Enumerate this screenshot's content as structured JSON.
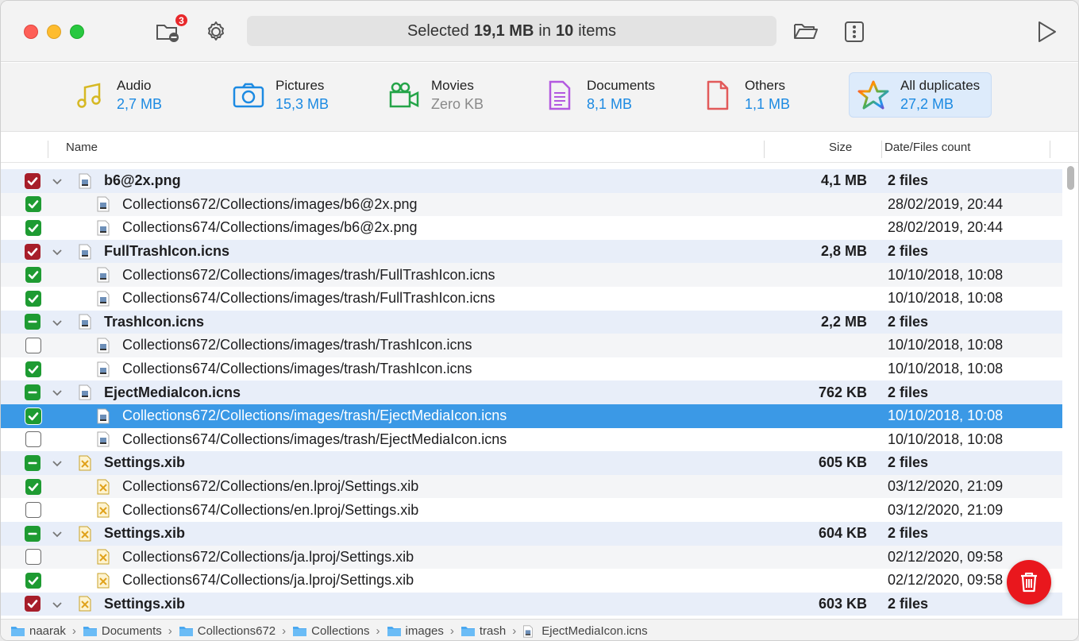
{
  "toolbar": {
    "badge_count": "3",
    "status_prefix": "Selected",
    "status_size": "19,1 MB",
    "status_in": "in",
    "status_count": "10",
    "status_suffix": "items"
  },
  "categories": [
    {
      "label": "Audio",
      "value": "2,7 MB",
      "icon": "music-note-icon",
      "color": "#d6b823"
    },
    {
      "label": "Pictures",
      "value": "15,3 MB",
      "icon": "camera-icon",
      "color": "#1c8ae2"
    },
    {
      "label": "Movies",
      "value": "Zero KB",
      "icon": "video-camera-icon",
      "color": "#24a448"
    },
    {
      "label": "Documents",
      "value": "8,1 MB",
      "icon": "document-icon",
      "color": "#b359e0"
    },
    {
      "label": "Others",
      "value": "1,1 MB",
      "icon": "file-icon",
      "color": "#e25a5a"
    },
    {
      "label": "All duplicates",
      "value": "27,2 MB",
      "icon": "rainbow-star-icon",
      "selected": true
    }
  ],
  "table": {
    "col_name": "Name",
    "col_size": "Size",
    "col_date": "Date/Files count",
    "groups": [
      {
        "name": "b6@2x.png",
        "size": "4,1 MB",
        "count": "2 files",
        "state": "checked-red",
        "icon": "image-file-icon",
        "children": [
          {
            "path": "Collections672/Collections/images/b6@2x.png",
            "date": "28/02/2019, 20:44",
            "checked": true
          },
          {
            "path": "Collections674/Collections/images/b6@2x.png",
            "date": "28/02/2019, 20:44",
            "checked": true
          }
        ]
      },
      {
        "name": "FullTrashIcon.icns",
        "size": "2,8 MB",
        "count": "2 files",
        "state": "checked-red",
        "icon": "image-file-icon",
        "children": [
          {
            "path": "Collections672/Collections/images/trash/FullTrashIcon.icns",
            "date": "10/10/2018, 10:08",
            "checked": true
          },
          {
            "path": "Collections674/Collections/images/trash/FullTrashIcon.icns",
            "date": "10/10/2018, 10:08",
            "checked": true
          }
        ]
      },
      {
        "name": "TrashIcon.icns",
        "size": "2,2 MB",
        "count": "2 files",
        "state": "mixed",
        "icon": "image-file-icon",
        "children": [
          {
            "path": "Collections672/Collections/images/trash/TrashIcon.icns",
            "date": "10/10/2018, 10:08",
            "checked": false
          },
          {
            "path": "Collections674/Collections/images/trash/TrashIcon.icns",
            "date": "10/10/2018, 10:08",
            "checked": true
          }
        ]
      },
      {
        "name": "EjectMediaIcon.icns",
        "size": "762 KB",
        "count": "2 files",
        "state": "mixed",
        "icon": "image-file-icon",
        "children": [
          {
            "path": "Collections672/Collections/images/trash/EjectMediaIcon.icns",
            "date": "10/10/2018, 10:08",
            "checked": true,
            "selected": true
          },
          {
            "path": "Collections674/Collections/images/trash/EjectMediaIcon.icns",
            "date": "10/10/2018, 10:08",
            "checked": false
          }
        ]
      },
      {
        "name": "Settings.xib",
        "size": "605 KB",
        "count": "2 files",
        "state": "mixed",
        "icon": "xib-file-icon",
        "children": [
          {
            "path": "Collections672/Collections/en.lproj/Settings.xib",
            "date": "03/12/2020, 21:09",
            "checked": true
          },
          {
            "path": "Collections674/Collections/en.lproj/Settings.xib",
            "date": "03/12/2020, 21:09",
            "checked": false
          }
        ]
      },
      {
        "name": "Settings.xib",
        "size": "604 KB",
        "count": "2 files",
        "state": "mixed",
        "icon": "xib-file-icon",
        "children": [
          {
            "path": "Collections672/Collections/ja.lproj/Settings.xib",
            "date": "02/12/2020, 09:58",
            "checked": false
          },
          {
            "path": "Collections674/Collections/ja.lproj/Settings.xib",
            "date": "02/12/2020, 09:58",
            "checked": true
          }
        ]
      },
      {
        "name": "Settings.xib",
        "size": "603 KB",
        "count": "2 files",
        "state": "checked-red",
        "icon": "xib-file-icon",
        "children": []
      }
    ]
  },
  "pathbar": [
    {
      "label": "naarak",
      "icon": "home-folder-icon"
    },
    {
      "label": "Documents",
      "icon": "folder-icon"
    },
    {
      "label": "Collections672",
      "icon": "folder-icon"
    },
    {
      "label": "Collections",
      "icon": "folder-icon"
    },
    {
      "label": "images",
      "icon": "folder-icon"
    },
    {
      "label": "trash",
      "icon": "folder-icon"
    },
    {
      "label": "EjectMediaIcon.icns",
      "icon": "image-file-icon"
    }
  ]
}
